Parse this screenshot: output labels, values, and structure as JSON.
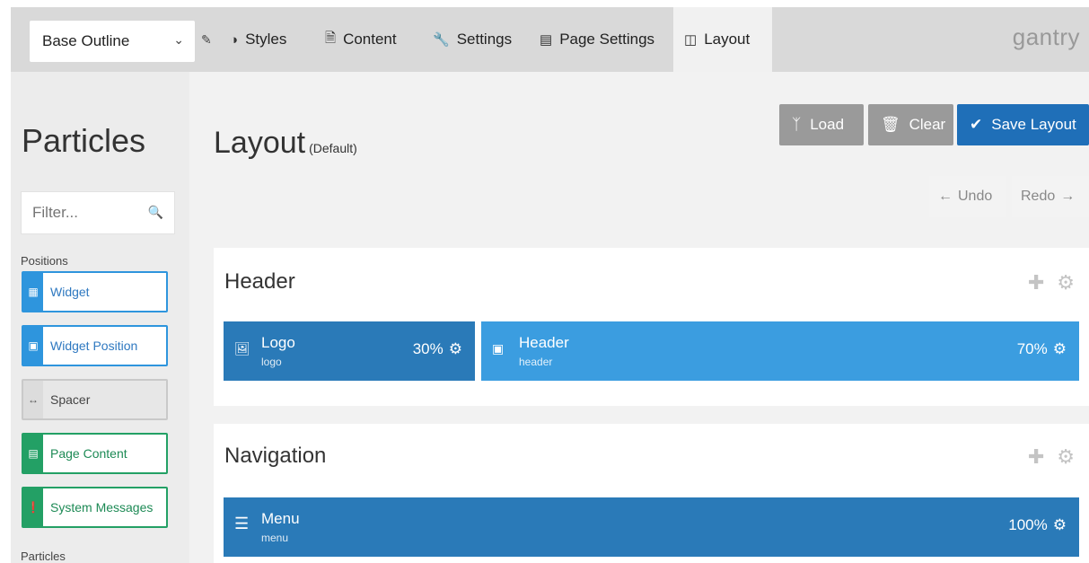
{
  "topbar": {
    "outline": {
      "label": "Base Outline"
    },
    "tabs": [
      {
        "label": "Styles",
        "icon": "contrast-icon"
      },
      {
        "label": "Content",
        "icon": "document-icon"
      },
      {
        "label": "Settings",
        "icon": "wrench-icon"
      },
      {
        "label": "Page Settings",
        "icon": "window-icon"
      },
      {
        "label": "Layout",
        "icon": "columns-icon",
        "active": true
      }
    ],
    "brand": "gantry"
  },
  "sidebar": {
    "title": "Particles",
    "filter_placeholder": "Filter...",
    "positions_label": "Positions",
    "particles_label": "Particles",
    "items": [
      {
        "label": "Widget",
        "color": "#2e95dd"
      },
      {
        "label": "Widget Position",
        "color": "#2e95dd"
      },
      {
        "label": "Spacer",
        "color": "#c9c9c9"
      },
      {
        "label": "Page Content",
        "color": "#23a065"
      },
      {
        "label": "System Messages",
        "color": "#23a065"
      }
    ]
  },
  "main": {
    "title": "Layout",
    "subtitle": "(Default)",
    "buttons": {
      "load": "Load",
      "clear": "Clear",
      "save": "Save Layout"
    },
    "undo": "Undo",
    "redo": "Redo",
    "sections": [
      {
        "title": "Header",
        "blocks": [
          {
            "name": "Logo",
            "key": "logo",
            "percent": "30%"
          },
          {
            "name": "Header",
            "key": "header",
            "percent": "70%"
          }
        ]
      },
      {
        "title": "Navigation",
        "blocks": [
          {
            "name": "Menu",
            "key": "menu",
            "percent": "100%"
          }
        ]
      }
    ]
  },
  "colors": {
    "accent": "#1f6fb8",
    "position": "#3b9de0",
    "green": "#23a065"
  }
}
